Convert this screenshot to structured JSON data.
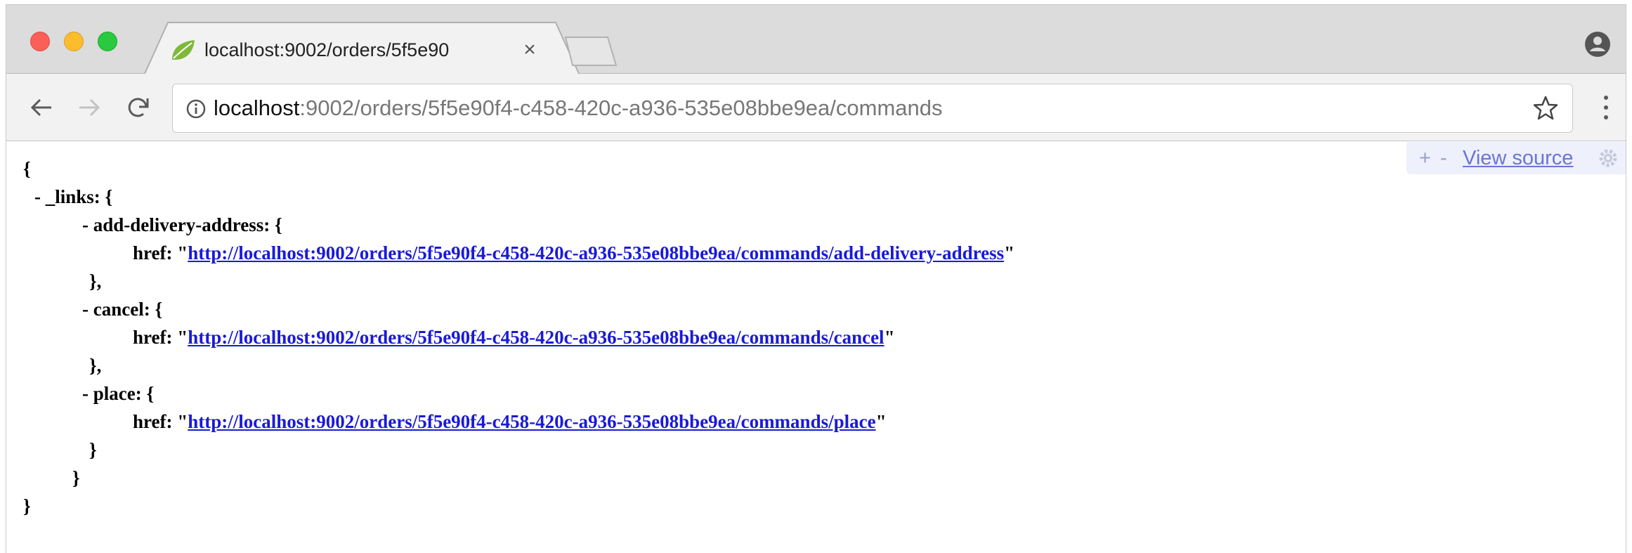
{
  "tab": {
    "title": "localhost:9002/orders/5f5e90",
    "close": "×"
  },
  "address_bar": {
    "host": "localhost",
    "path": ":9002/orders/5f5e90f4-c458-420c-a936-535e08bbe9ea/commands"
  },
  "viewer": {
    "plus": "+",
    "minus": "-",
    "view_source": "View source"
  },
  "icons": {
    "favicon": "spring-leaf-icon",
    "profile": "person-icon",
    "back": "back-arrow-icon",
    "forward": "forward-arrow-icon",
    "reload": "reload-icon",
    "info": "info-icon",
    "star": "star-icon",
    "menu": "kebab-menu-icon",
    "gear": "gear-icon"
  },
  "colors": {
    "close_dot": "#fc5f57",
    "minimize_dot": "#fdbc2e",
    "zoom_dot": "#29c940",
    "link": "#1a1ad8",
    "viewer_toolbar": "#eef0fb"
  },
  "json": {
    "open_brace": "{",
    "links_key": "- _links: {",
    "add_delivery_key": "- add-delivery-address: {",
    "add_delivery_href_key": "href: \"",
    "add_delivery_url": "http://localhost:9002/orders/5f5e90f4-c458-420c-a936-535e08bbe9ea/commands/add-delivery-address",
    "add_delivery_close": "},",
    "cancel_key": "- cancel: {",
    "cancel_href_key": "href: \"",
    "cancel_url": "http://localhost:9002/orders/5f5e90f4-c458-420c-a936-535e08bbe9ea/commands/cancel",
    "cancel_close": "},",
    "place_key": "- place: {",
    "place_href_key": "href: \"",
    "place_url": "http://localhost:9002/orders/5f5e90f4-c458-420c-a936-535e08bbe9ea/commands/place",
    "place_close": "}",
    "links_close": "}",
    "close_brace": "}",
    "quote": "\""
  }
}
